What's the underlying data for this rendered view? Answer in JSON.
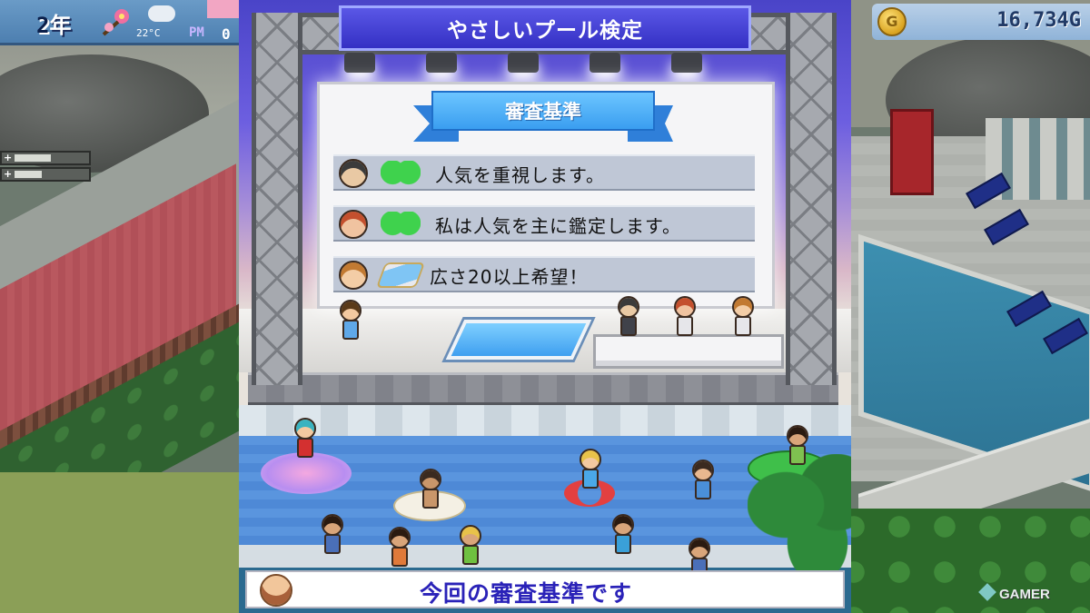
{
  "hud": {
    "year_number": "2",
    "year_label": "年",
    "temperature": "22°C",
    "period": "PM",
    "clock_partial": "0",
    "coin_glyph": "G",
    "money": "16,734G"
  },
  "game": {
    "title": "やさしいプール検定",
    "criteria_header": "審査基準",
    "criteria": [
      {
        "judge": "judge-1",
        "icon": "popularity-hearts-icon",
        "text": "人気を重視します。"
      },
      {
        "judge": "judge-2",
        "icon": "popularity-hearts-icon",
        "text": "私は人気を主に鑑定します。"
      },
      {
        "judge": "judge-3",
        "icon": "pool-size-icon",
        "text": "広さ20以上希望！"
      }
    ],
    "dialog_text": "今回の審査基準です"
  },
  "watermark": "GAMER",
  "colors": {
    "title_banner": "#3430c4",
    "ribbon": "#3a9ef0",
    "row_bg": "#bfc7d6",
    "dialog_text": "#2a22b8",
    "hearts": "#3fd24d"
  }
}
